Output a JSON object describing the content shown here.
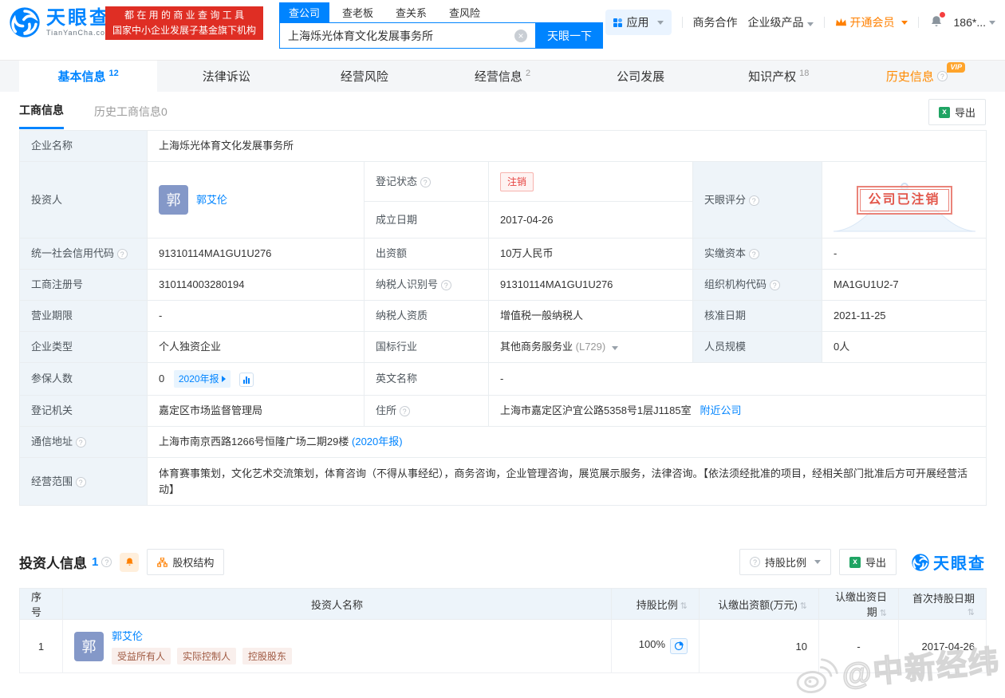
{
  "colors": {
    "accent": "#0084ff",
    "promo_red": "#df2e24",
    "danger_red": "#e64340",
    "vip_orange": "#ff8a00",
    "member_orange": "#ff8000",
    "label_bg": "#eef4f9"
  },
  "icons": {
    "question": "?",
    "clear": "×",
    "sort": "⇅",
    "excel": "x",
    "avatar_char": "郭"
  },
  "header": {
    "brand": "天眼查",
    "brand_domain": "TianYanCha.com",
    "promo_line1": "都 在 用 的 商 业 查 询 工 具",
    "promo_line2": "国家中小企业发展子基金旗下机构",
    "search_tabs": [
      "查公司",
      "查老板",
      "查关系",
      "查风险"
    ],
    "search_value": "上海烁光体育文化发展事务所",
    "search_button": "天眼一下",
    "nav_app": "应用",
    "nav_cooperation": "商务合作",
    "nav_enterprise": "企业级产品",
    "nav_vip": "开通会员",
    "nav_account": "186*..."
  },
  "tabs": {
    "items": [
      {
        "label": "基本信息",
        "count": "12"
      },
      {
        "label": "法律诉讼",
        "count": ""
      },
      {
        "label": "经营风险",
        "count": ""
      },
      {
        "label": "经营信息",
        "count": "2"
      },
      {
        "label": "公司发展",
        "count": ""
      },
      {
        "label": "知识产权",
        "count": "18"
      },
      {
        "label": "历史信息",
        "count": "",
        "vip": "VIP"
      }
    ]
  },
  "subtabs": {
    "current": "工商信息",
    "history": "历史工商信息0",
    "export_label": "导出"
  },
  "info": {
    "company_name_label": "企业名称",
    "company_name": "上海烁光体育文化发展事务所",
    "investor_label": "投资人",
    "investor_avatar": "郭",
    "investor_name": "郭艾伦",
    "reg_status_label": "登记状态",
    "reg_status": "注销",
    "establish_label": "成立日期",
    "establish_date": "2017-04-26",
    "score_label": "天眼评分",
    "stamp": "公司已注销",
    "uscc_label": "统一社会信用代码",
    "uscc": "91310114MA1GU1U276",
    "capital_label": "出资额",
    "capital": "10万人民币",
    "paidin_label": "实缴资本",
    "paidin": "-",
    "regno_label": "工商注册号",
    "regno": "310114003280194",
    "taxid_label": "纳税人识别号",
    "taxid": "91310114MA1GU1U276",
    "orgcode_label": "组织机构代码",
    "orgcode": "MA1GU1U2-7",
    "term_label": "营业期限",
    "term": "-",
    "taxpayer_label": "纳税人资质",
    "taxpayer": "增值税一般纳税人",
    "approve_label": "核准日期",
    "approve_date": "2021-11-25",
    "type_label": "企业类型",
    "type": "个人独资企业",
    "industry_label": "国标行业",
    "industry": "其他商务服务业",
    "industry_code": "(L729)",
    "staff_label": "人员规模",
    "staff": "0人",
    "insured_label": "参保人数",
    "insured": "0",
    "insured_report": "2020年报",
    "english_label": "英文名称",
    "english": "-",
    "authority_label": "登记机关",
    "authority": "嘉定区市场监督管理局",
    "address_label": "住所",
    "address": "上海市嘉定区沪宜公路5358号1层J1185室",
    "address_nearby": "附近公司",
    "mail_label": "通信地址",
    "mail": "上海市南京西路1266号恒隆广场二期29楼",
    "mail_report": "(2020年报)",
    "scope_label": "经营范围",
    "scope": "体育赛事策划，文化艺术交流策划，体育咨询（不得从事经纪），商务咨询，企业管理咨询，展览展示服务，法律咨询。【依法须经批准的项目，经相关部门批准后方可开展经营活动】"
  },
  "investors": {
    "title": "投资人信息",
    "count": "1",
    "equity_button": "股权结构",
    "ratio_button": "持股比例",
    "export_label": "导出",
    "brand": "天眼查",
    "columns": [
      "序号",
      "投资人名称",
      "持股比例",
      "认缴出资额(万元)",
      "认缴出资日期",
      "首次持股日期"
    ],
    "rows": [
      {
        "index": "1",
        "avatar": "郭",
        "name": "郭艾伦",
        "tags": [
          "受益所有人",
          "实际控制人",
          "控股股东"
        ],
        "ratio": "100%",
        "amount": "10",
        "date": "-",
        "first_date": "2017-04-26"
      }
    ]
  },
  "watermark": "@中新经纬"
}
